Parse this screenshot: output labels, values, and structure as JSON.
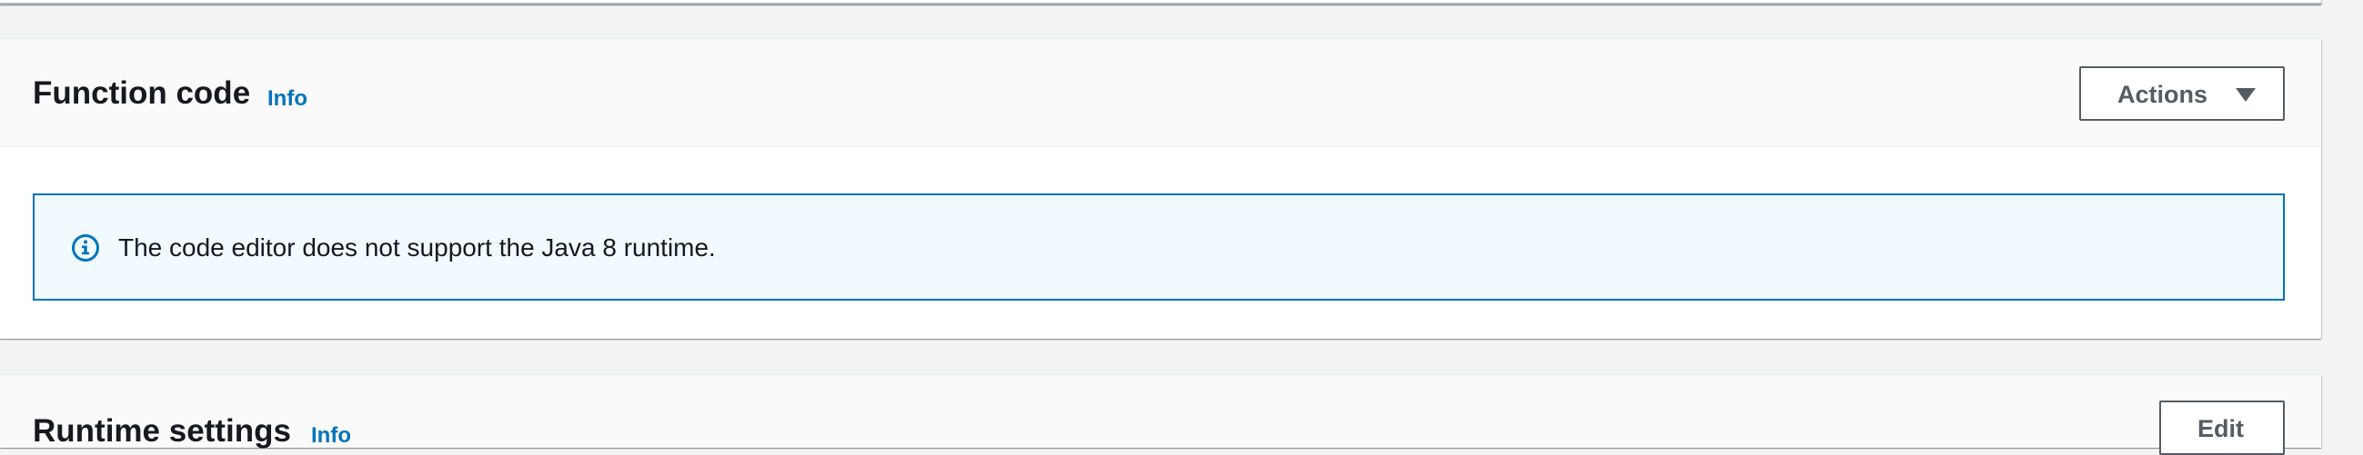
{
  "function_code": {
    "title": "Function code",
    "info_label": "Info",
    "actions_label": "Actions",
    "alert": {
      "icon": "info-circle-icon",
      "message": "The code editor does not support the Java 8 runtime."
    }
  },
  "runtime_settings": {
    "title": "Runtime settings",
    "info_label": "Info",
    "edit_label": "Edit"
  },
  "colors": {
    "link": "#0073bb",
    "alert_border": "#0073bb",
    "alert_background": "#f1faff",
    "text": "#16191f",
    "button_border": "#545b64",
    "page_background": "#f2f3f3"
  }
}
